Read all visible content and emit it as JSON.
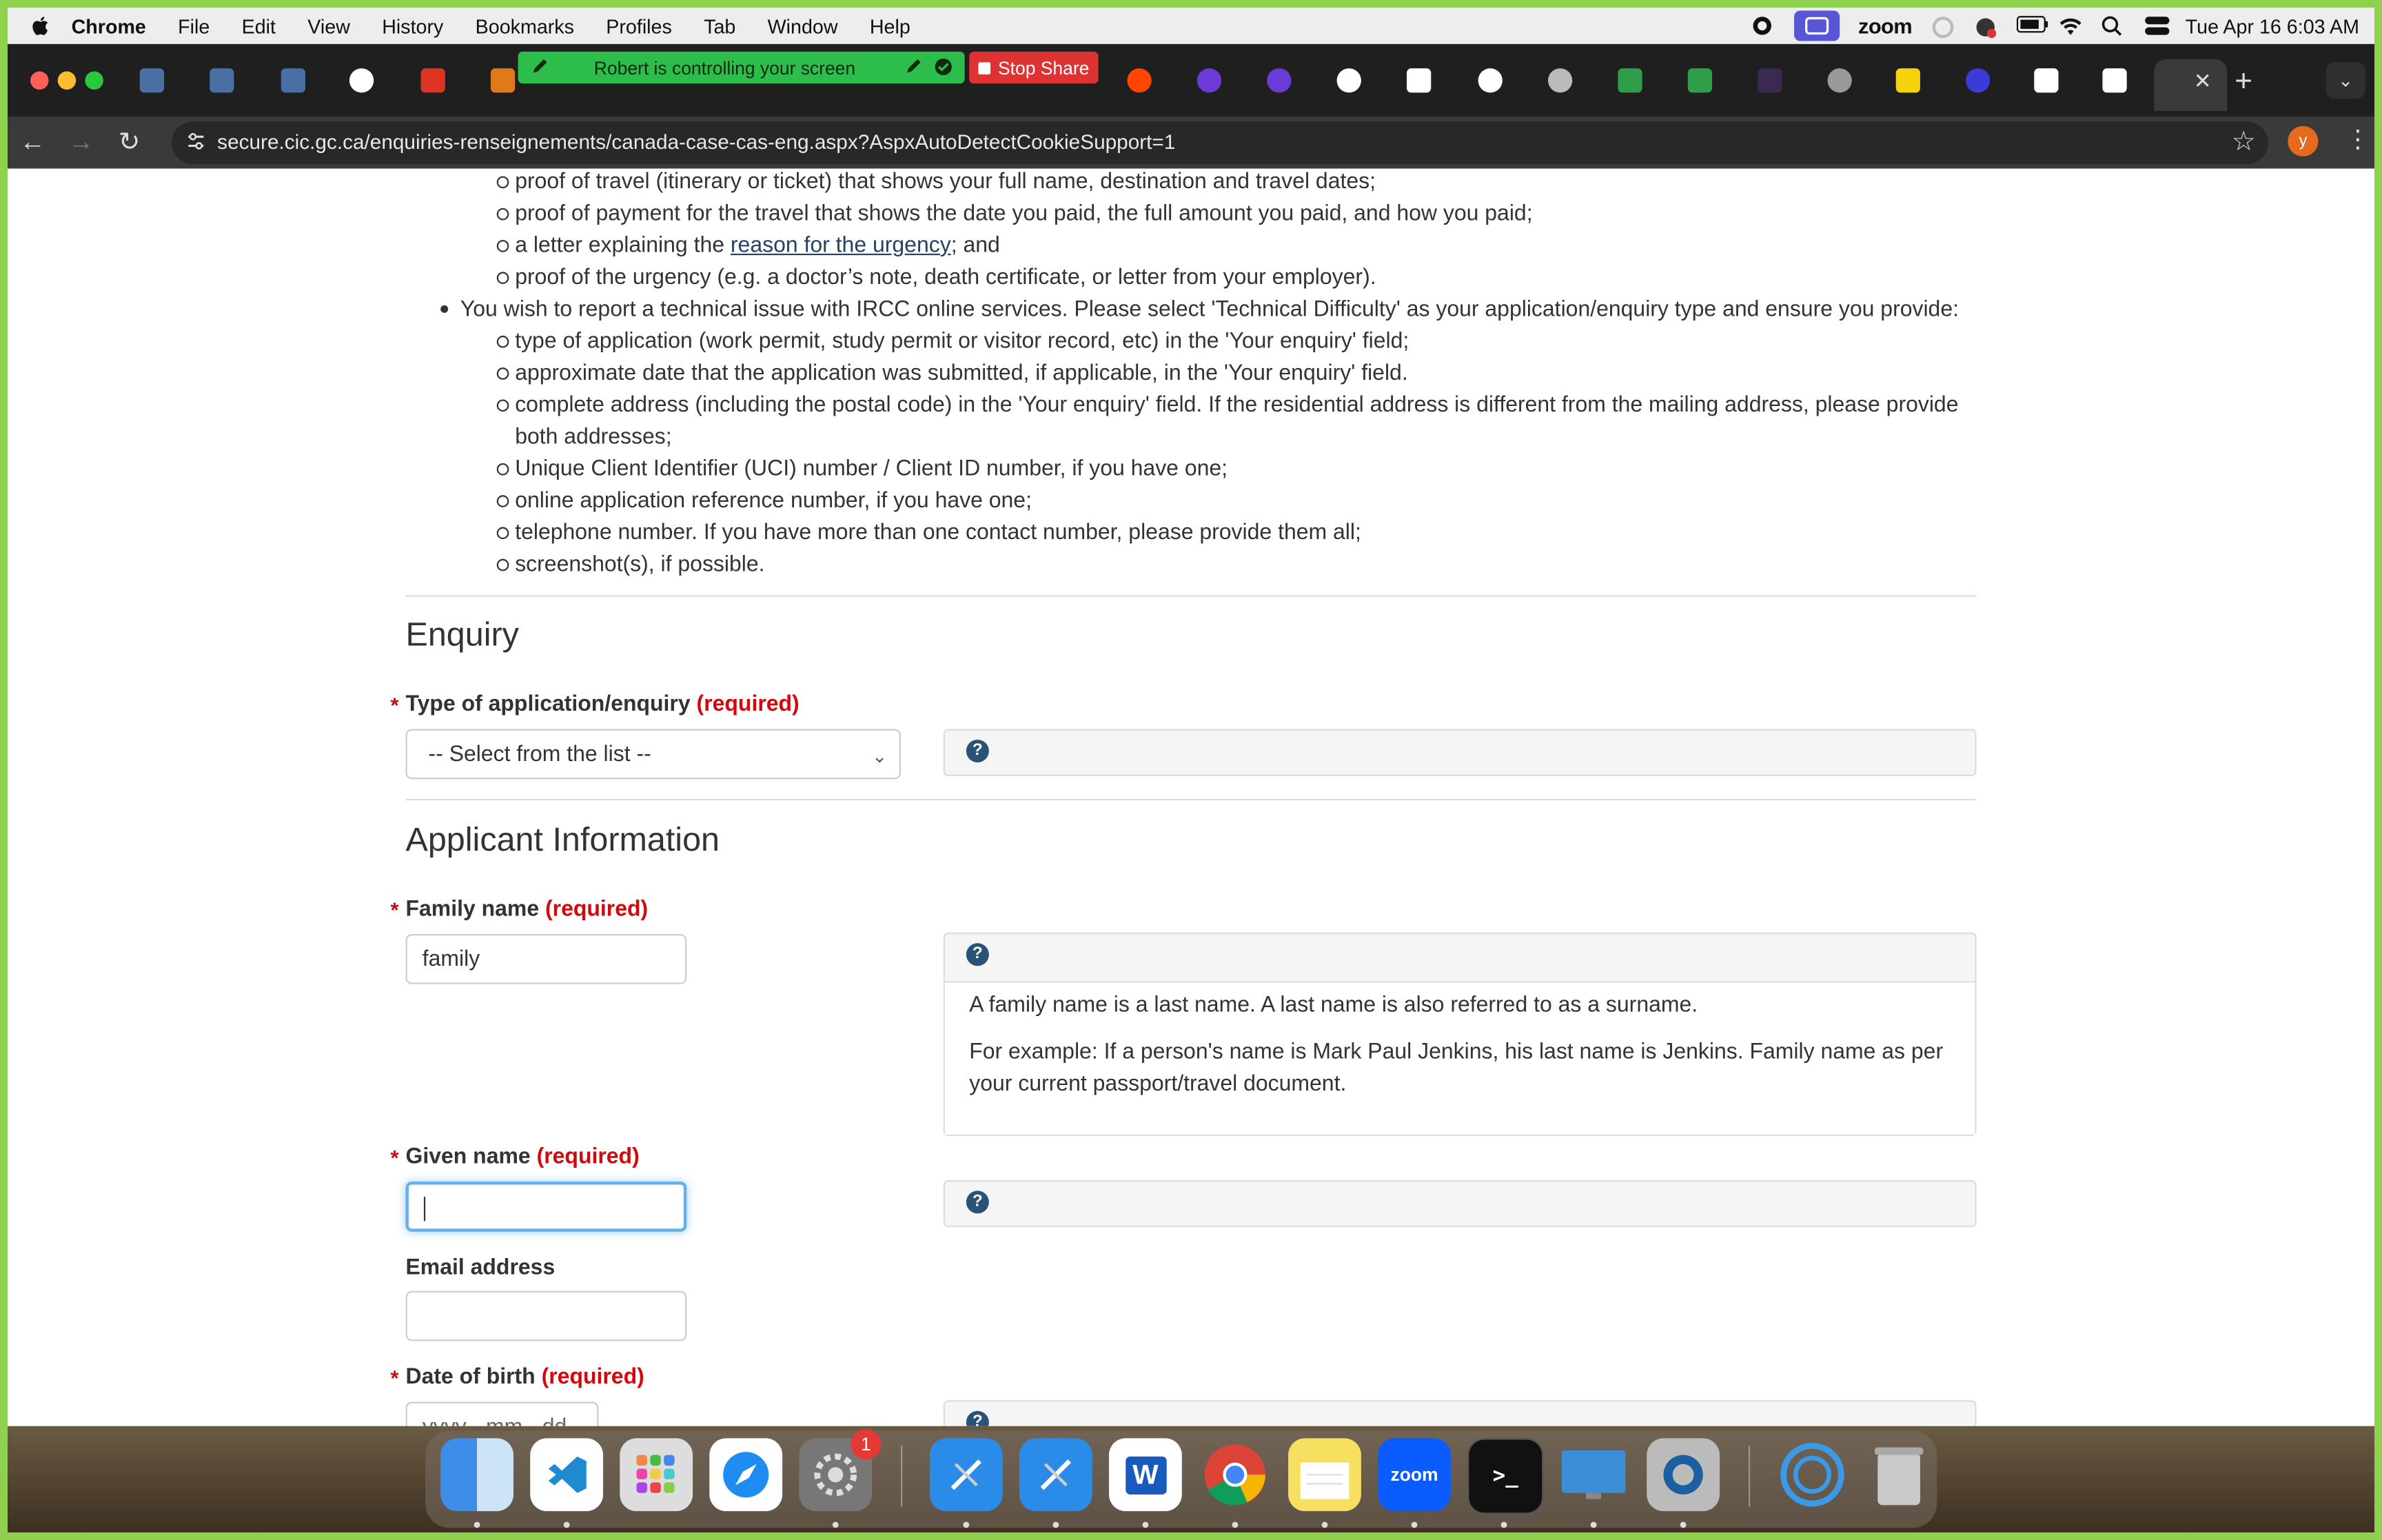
{
  "menubar": {
    "items": [
      "Chrome",
      "File",
      "Edit",
      "View",
      "History",
      "Bookmarks",
      "Profiles",
      "Tab",
      "Window",
      "Help"
    ],
    "zoom_label": "zoom",
    "datetime": "Tue Apr 16  6:03 AM"
  },
  "tabstrip": {
    "control_banner": "Robert is controlling your screen",
    "stop_share": "Stop Share",
    "new_tab": "+"
  },
  "toolbar": {
    "url": "secure.cic.gc.ca/enquiries-renseignements/canada-case-cas-eng.aspx?AspxAutoDetectCookieSupport=1",
    "profile_initial": "y"
  },
  "content": {
    "urgent_list": [
      "proof of travel (itinerary or ticket) that shows your full name, destination and travel dates;",
      "proof of payment for the travel that shows the date you paid, the full amount you paid, and how you paid;",
      "proof of the urgency (e.g. a doctor’s note, death certificate, or letter from your employer)."
    ],
    "urgency_letter_prefix": "a letter explaining the ",
    "urgency_link": "reason for the urgency",
    "urgency_letter_suffix": "; and",
    "technical_bullet": "You wish to report a technical issue with IRCC online services. Please select 'Technical Difficulty' as your application/enquiry type and ensure you provide:",
    "technical_list": [
      "type of application (work permit, study permit or visitor record, etc) in the 'Your enquiry' field;",
      "approximate date that the application was submitted, if applicable, in the 'Your enquiry' field.",
      "complete address (including the postal code) in the 'Your enquiry' field. If the residential address is different from the mailing address, please provide",
      "both addresses;",
      "Unique Client Identifier (UCI) number / Client ID number, if you have one;",
      "online application reference number, if you have one;",
      "telephone number. If you have more than one contact number, please provide them all;",
      "screenshot(s), if possible."
    ]
  },
  "enquiry": {
    "heading": "Enquiry",
    "type_label": "Type of application/enquiry",
    "required": "(required)",
    "type_select_value": "-- Select from the list --"
  },
  "applicant": {
    "heading": "Applicant Information",
    "family_label": "Family name",
    "family_value": "family",
    "family_help": [
      "A family name is a last name. A last name is also referred to as a surname.",
      "For example: If a person's name is Mark Paul Jenkins, his last name is Jenkins. Family name as per",
      "your current passport/travel document."
    ],
    "given_label": "Given name",
    "given_value": "",
    "email_label": "Email address",
    "email_value": "",
    "dob_label": "Date of birth",
    "dob_placeholder": "yyyy - mm - dd"
  },
  "dock": {
    "word_label": "W",
    "zoom_label": "zoom",
    "settings_badge": "1"
  },
  "colors": {
    "required_red": "#d3080c",
    "link_blue": "#284162",
    "help_icon": "#295376",
    "focus_blue": "#66afe9",
    "share_green": "#2dbd4a",
    "stop_red": "#dd3333"
  }
}
